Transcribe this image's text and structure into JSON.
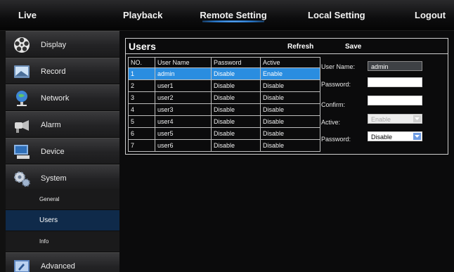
{
  "nav": {
    "live": "Live",
    "playback": "Playback",
    "remote_setting": "Remote Setting",
    "local_setting": "Local Setting",
    "logout": "Logout"
  },
  "sidebar": {
    "items": [
      {
        "label": "Display",
        "icon": "display-icon"
      },
      {
        "label": "Record",
        "icon": "record-icon"
      },
      {
        "label": "Network",
        "icon": "network-icon"
      },
      {
        "label": "Alarm",
        "icon": "alarm-icon"
      },
      {
        "label": "Device",
        "icon": "device-icon"
      },
      {
        "label": "System",
        "icon": "system-icon"
      }
    ],
    "sub_items": [
      {
        "label": "General"
      },
      {
        "label": "Users",
        "active": true
      },
      {
        "label": "Info"
      }
    ],
    "advanced": {
      "label": "Advanced",
      "icon": "advanced-icon"
    }
  },
  "panel": {
    "title": "Users",
    "refresh_label": "Refresh",
    "save_label": "Save"
  },
  "table": {
    "headers": [
      "NO.",
      "User Name",
      "Password",
      "Active"
    ],
    "rows": [
      [
        "1",
        "admin",
        "Disable",
        "Enable"
      ],
      [
        "2",
        "user1",
        "Disable",
        "Disable"
      ],
      [
        "3",
        "user2",
        "Disable",
        "Disable"
      ],
      [
        "4",
        "user3",
        "Disable",
        "Disable"
      ],
      [
        "5",
        "user4",
        "Disable",
        "Disable"
      ],
      [
        "6",
        "user5",
        "Disable",
        "Disable"
      ],
      [
        "7",
        "user6",
        "Disable",
        "Disable"
      ]
    ],
    "selected_row": 0
  },
  "form": {
    "username_label": "User Name:",
    "username_value": "admin",
    "password_label": "Password:",
    "confirm_label": "Confirm:",
    "active_label": "Active:",
    "active_value": "Enable",
    "password_select_label": "Password:",
    "password_select_value": "Disable"
  },
  "colors": {
    "selected_row": "#2a8de0",
    "active_nav_glow": "#2a7fd8"
  }
}
